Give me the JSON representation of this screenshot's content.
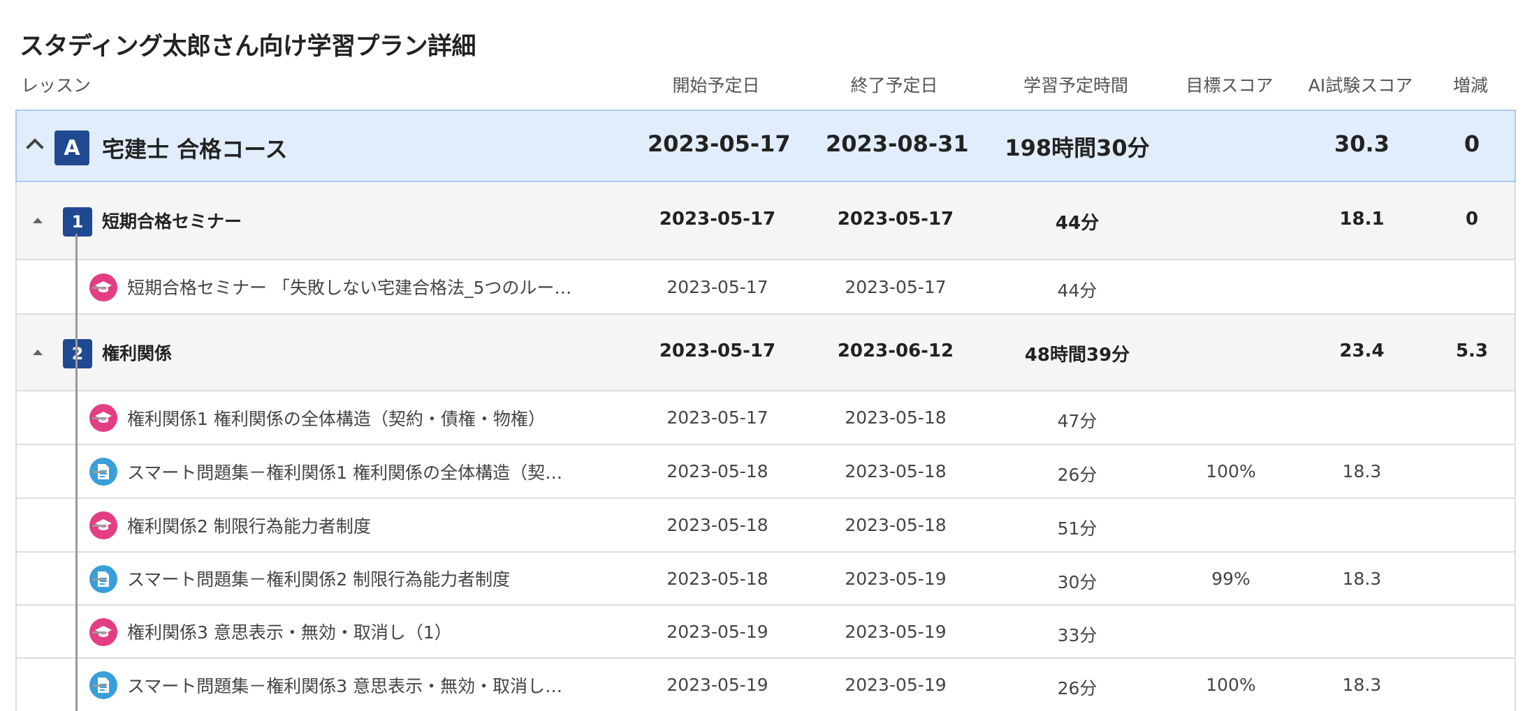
{
  "page_title": "スタディング太郎さん向け学習プラン詳細",
  "columns": {
    "lesson": "レッスン",
    "start": "開始予定日",
    "end": "終了予定日",
    "study_time": "学習予定時間",
    "target_score": "目標スコア",
    "ai_score": "AI試験スコア",
    "change": "増減"
  },
  "course": {
    "badge": "A",
    "title": "宅建士 合格コース",
    "start": "2023-05-17",
    "end": "2023-08-31",
    "study_time": "198時間30分",
    "target_score": "",
    "ai_score": "30.3",
    "change": "0"
  },
  "sections": [
    {
      "badge": "1",
      "title": "短期合格セミナー",
      "start": "2023-05-17",
      "end": "2023-05-17",
      "study_time": "44分",
      "target_score": "",
      "ai_score": "18.1",
      "change": "0",
      "lessons": [
        {
          "type": "lecture",
          "icon": "mortarboard-icon",
          "title": "短期合格セミナー 「失敗しない宅建合格法_5つのルー…",
          "start": "2023-05-17",
          "end": "2023-05-17",
          "study_time": "44分",
          "target_score": "",
          "ai_score": ""
        }
      ]
    },
    {
      "badge": "2",
      "title": "権利関係",
      "start": "2023-05-17",
      "end": "2023-06-12",
      "study_time": "48時間39分",
      "target_score": "",
      "ai_score": "23.4",
      "change": "5.3",
      "lessons": [
        {
          "type": "lecture",
          "icon": "mortarboard-icon",
          "title": "権利関係1 権利関係の全体構造（契約・債権・物権）",
          "start": "2023-05-17",
          "end": "2023-05-18",
          "study_time": "47分",
          "target_score": "",
          "ai_score": ""
        },
        {
          "type": "exercise",
          "icon": "document-icon",
          "title": "スマート問題集－権利関係1 権利関係の全体構造（契…",
          "start": "2023-05-18",
          "end": "2023-05-18",
          "study_time": "26分",
          "target_score": "100%",
          "ai_score": "18.3"
        },
        {
          "type": "lecture",
          "icon": "mortarboard-icon",
          "title": "権利関係2 制限行為能力者制度",
          "start": "2023-05-18",
          "end": "2023-05-18",
          "study_time": "51分",
          "target_score": "",
          "ai_score": ""
        },
        {
          "type": "exercise",
          "icon": "document-icon",
          "title": "スマート問題集－権利関係2 制限行為能力者制度",
          "start": "2023-05-18",
          "end": "2023-05-19",
          "study_time": "30分",
          "target_score": "99%",
          "ai_score": "18.3"
        },
        {
          "type": "lecture",
          "icon": "mortarboard-icon",
          "title": "権利関係3 意思表示・無効・取消し（1）",
          "start": "2023-05-19",
          "end": "2023-05-19",
          "study_time": "33分",
          "target_score": "",
          "ai_score": ""
        },
        {
          "type": "exercise",
          "icon": "document-icon",
          "title": "スマート問題集－権利関係3 意思表示・無効・取消し…",
          "start": "2023-05-19",
          "end": "2023-05-19",
          "study_time": "26分",
          "target_score": "100%",
          "ai_score": "18.3"
        }
      ]
    }
  ],
  "colors": {
    "badge": "#1f4a91",
    "lecture_icon": "#e33d84",
    "exercise_icon": "#3a9fd9",
    "course_row_bg": "#e2edfb",
    "course_row_border": "#a9c8f0",
    "section_bg": "#f5f5f5"
  }
}
